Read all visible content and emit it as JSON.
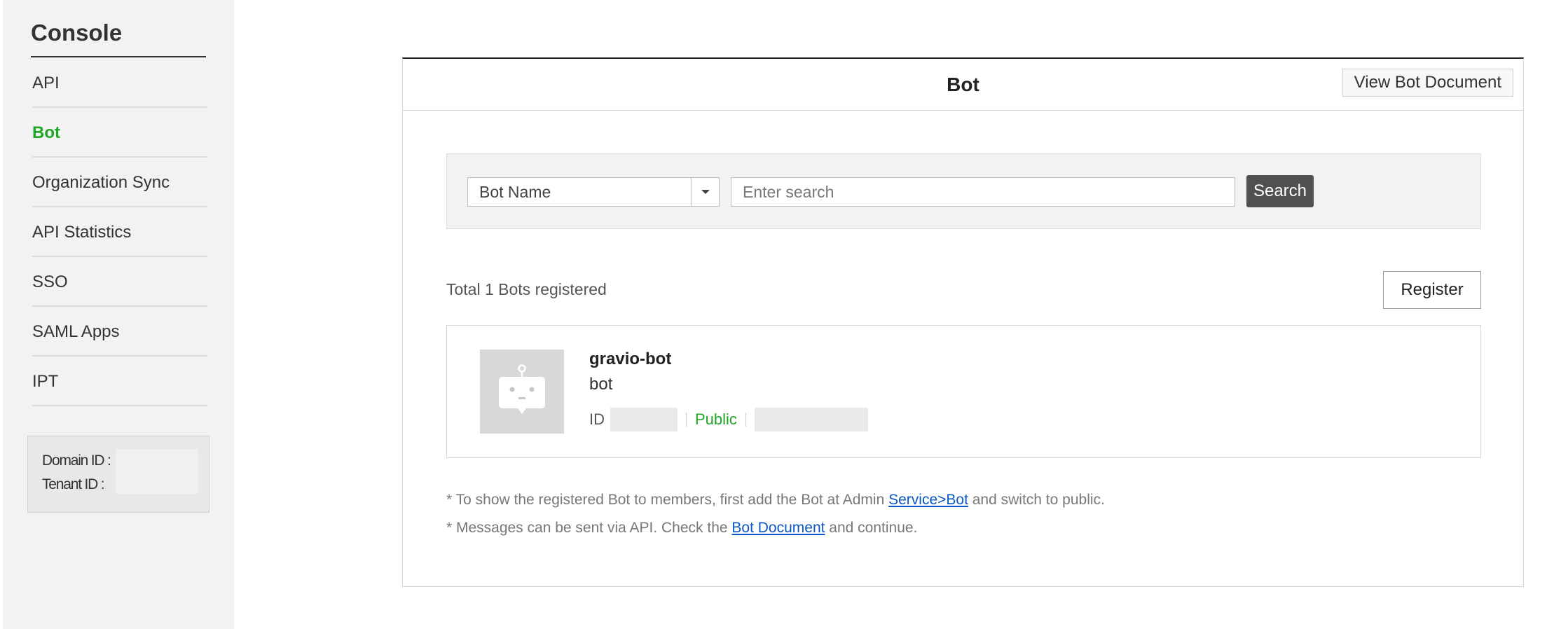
{
  "sidebar": {
    "title": "Console",
    "items": [
      {
        "label": "API"
      },
      {
        "label": "Bot"
      },
      {
        "label": "Organization Sync"
      },
      {
        "label": "API Statistics"
      },
      {
        "label": "SSO"
      },
      {
        "label": "SAML Apps"
      },
      {
        "label": "IPT"
      }
    ],
    "domain_label": "Domain ID :",
    "tenant_label": "Tenant ID :"
  },
  "main": {
    "title": "Bot",
    "view_doc_label": "View Bot Document",
    "search": {
      "select_value": "Bot Name",
      "placeholder": "Enter search",
      "button_label": "Search"
    },
    "total_text": "Total 1 Bots registered",
    "register_label": "Register",
    "bot": {
      "name": "gravio-bot",
      "type": "bot",
      "id_label": "ID",
      "status": "Public"
    },
    "notes": {
      "line1_pre": "* To show the registered Bot to members, first add the Bot at Admin ",
      "line1_link": "Service>Bot",
      "line1_post": " and switch to public.",
      "line2_pre": "* Messages can be sent via API. Check the ",
      "line2_link": "Bot Document",
      "line2_post": " and continue."
    }
  },
  "colors": {
    "accent_green": "#1ea624",
    "link_blue": "#0a57c4",
    "search_button": "#505050"
  }
}
